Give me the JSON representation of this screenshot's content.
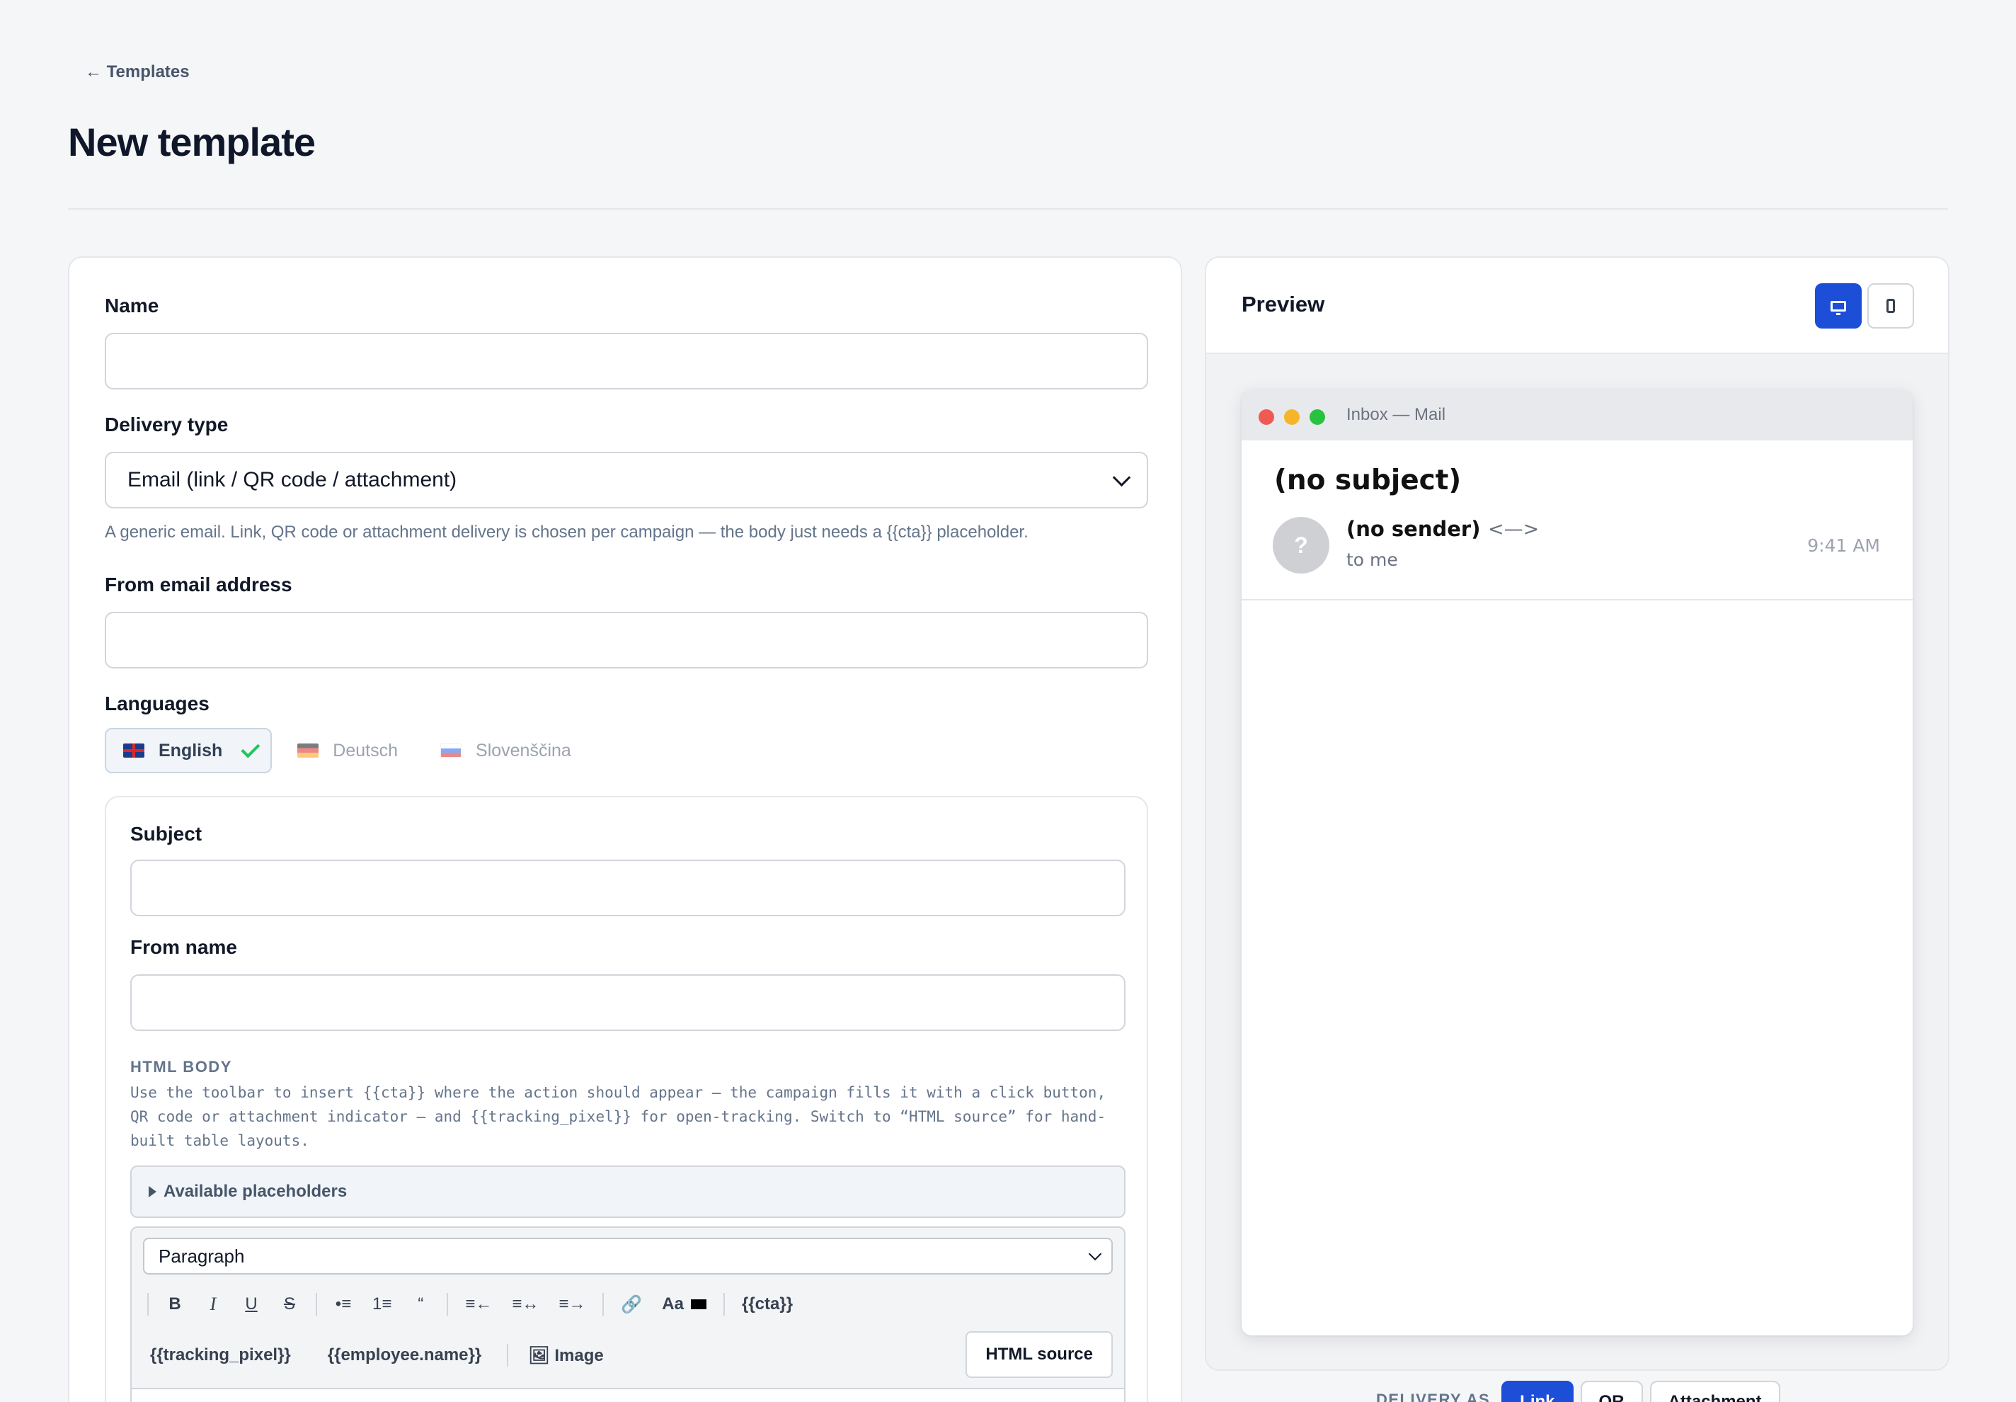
{
  "header": {
    "back_link": "← Templates",
    "title": "New template"
  },
  "form": {
    "name": {
      "label": "Name",
      "value": "",
      "placeholder": ""
    },
    "delivery_type": {
      "label": "Delivery type",
      "selected": "Email (link / QR code / attachment)",
      "help": "A generic email. Link, QR code or attachment delivery is chosen per campaign — the body just needs a {{cta}} placeholder."
    },
    "from_email": {
      "label": "From email address",
      "value": "",
      "placeholder": ""
    },
    "languages": {
      "label": "Languages",
      "items": [
        {
          "label": "English",
          "icon": "flag-uk-icon",
          "active": true
        },
        {
          "label": "Deutsch",
          "icon": "flag-de-icon",
          "active": false
        },
        {
          "label": "Slovenščina",
          "icon": "flag-si-icon",
          "active": false
        }
      ]
    },
    "subject": {
      "label": "Subject",
      "value": ""
    },
    "from_name": {
      "label": "From name",
      "value": ""
    },
    "html_body": {
      "label": "HTML BODY",
      "help": "Use the toolbar to insert {{cta}} where the action should appear — the campaign fills it with a click button, QR code or attachment indicator — and {{tracking_pixel}} for open-tracking. Switch to “HTML source” for hand-built table layouts.",
      "placeholders_toggle": "Available placeholders",
      "block_format": "Paragraph",
      "toolbar": {
        "bold": "B",
        "italic": "I",
        "underline": "U",
        "strike": "S",
        "bullet_list": "•≡",
        "ordered_list": "1≡",
        "quote": "“",
        "align_left": "≡←",
        "align_center": "≡↔",
        "align_right": "≡→",
        "link": "🔗",
        "text_color": "Aa",
        "cta": "{{cta}}",
        "tracking_pixel": "{{tracking_pixel}}",
        "employee_name": "{{employee.name}}",
        "image": "🖼 Image",
        "html_source": "HTML source"
      }
    }
  },
  "preview": {
    "title": "Preview",
    "device_modes": [
      {
        "icon": "desktop-icon",
        "active": true
      },
      {
        "icon": "mobile-icon",
        "active": false
      }
    ],
    "mail": {
      "window_title": "Inbox — Mail",
      "subject": "(no subject)",
      "avatar_letter": "?",
      "sender": "(no sender)",
      "sender_address": "<—>",
      "recipient": "to me",
      "time": "9:41 AM"
    },
    "delivery_as": {
      "label": "DELIVERY AS",
      "options": [
        {
          "label": "Link",
          "active": true
        },
        {
          "label": "QR",
          "active": false
        },
        {
          "label": "Attachment",
          "active": false
        }
      ]
    }
  },
  "colors": {
    "accent": "#1d4ed8",
    "check": "#22c55e",
    "dot_red": "#ef5a52",
    "dot_yellow": "#f5b52b",
    "dot_green": "#29c240"
  }
}
